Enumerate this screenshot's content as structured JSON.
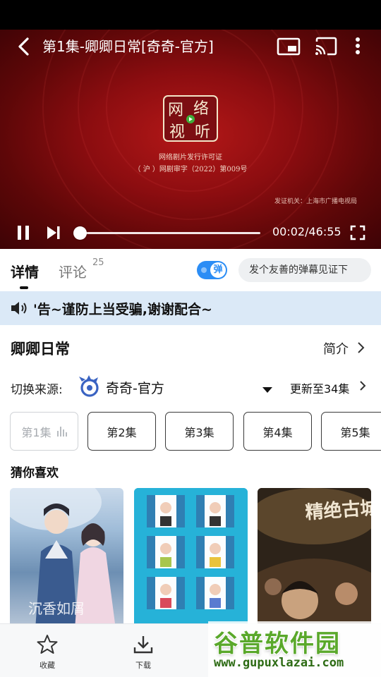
{
  "player": {
    "title": "第1集-卿卿日常[奇奇-官方]",
    "logo_text": [
      "网",
      "络",
      "视",
      "听"
    ],
    "license_line_1": "网络剧片发行许可证",
    "license_line_2": "（ 沪 ）网剧审字（2022）第009号",
    "license_issuer": "发证机关：上海市广播电视局",
    "current_time": "00:02",
    "total_time": "46:55",
    "time_display": "00:02/46:55",
    "progress": 0.0007,
    "state": "playing",
    "accent_color": "#ffffff"
  },
  "tabs": {
    "detail_label": "详情",
    "comment_label": "评论",
    "comment_count": "25",
    "danmaku_toggle_label": "弹",
    "danmaku_toggle_on": true,
    "danmaku_placeholder": "发个友善的弹幕见证下",
    "toggle_color": "#2b8df5"
  },
  "notice": {
    "text": "'告~谨防上当受骗,谢谢配合~",
    "background": "#dbe9f7"
  },
  "show": {
    "title": "卿卿日常",
    "intro_label": "简介",
    "source_label": "切换来源:",
    "source_name": "奇奇-官方",
    "update_text": "更新至34集"
  },
  "episodes": [
    {
      "label": "第1集",
      "active": true
    },
    {
      "label": "第2集",
      "active": false
    },
    {
      "label": "第3集",
      "active": false
    },
    {
      "label": "第4集",
      "active": false
    },
    {
      "label": "第5集",
      "active": false
    }
  ],
  "recommend": {
    "title": "猜你喜欢",
    "items": [
      {
        "poster_title": "沉香如屑"
      },
      {
        "poster_title": ""
      },
      {
        "poster_title": "精绝古城"
      }
    ]
  },
  "bottom_bar": {
    "favorite_label": "收藏",
    "download_label": "下载"
  },
  "watermark": {
    "main": "谷普软件园",
    "url": "www.gupuxlazai.com"
  }
}
